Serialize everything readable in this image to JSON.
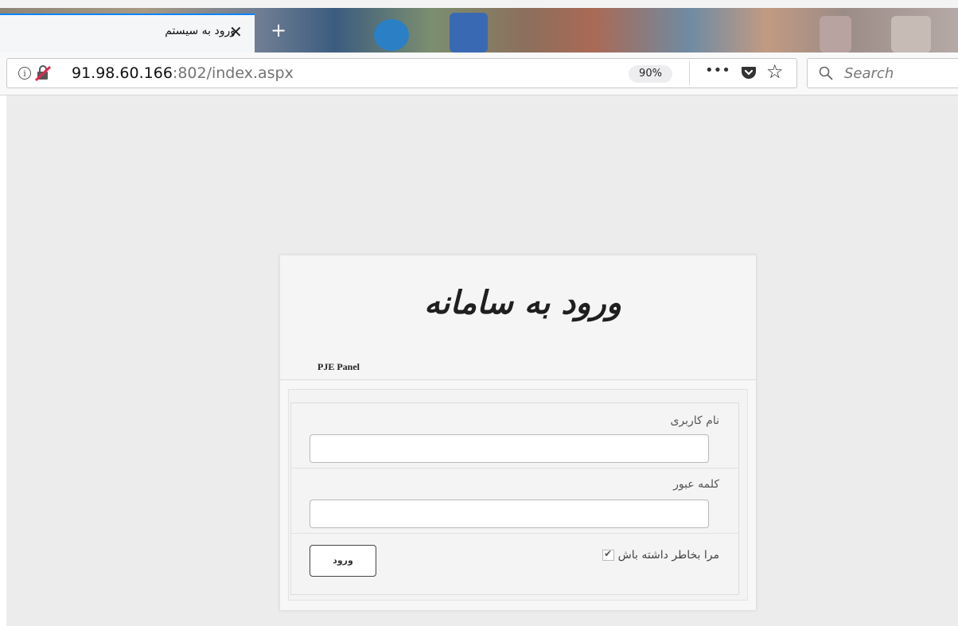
{
  "browser": {
    "tab": {
      "title": "ورود به سیستم",
      "close_glyph": "✕"
    },
    "new_tab_glyph": "+",
    "url": {
      "host": "91.98.60.166",
      "path": ":802/index.aspx"
    },
    "zoom": "90%",
    "more_glyph": "•••",
    "bookmark_glyph": "☆",
    "search_placeholder": "Search",
    "info_glyph": "i"
  },
  "login": {
    "brand_title": "ورود به سامانه",
    "brand_subtitle": "PJE Panel",
    "username_label": "نام کاربری",
    "username_value": "",
    "password_label": "کلمه عبور",
    "password_value": "",
    "remember_label": "مرا بخاطر داشته باش",
    "remember_checked": true,
    "submit_label": "ورود"
  },
  "colors": {
    "tab_accent": "#0a84ff",
    "page_bg": "#ececec",
    "panel_bg": "#f7f7f7"
  }
}
